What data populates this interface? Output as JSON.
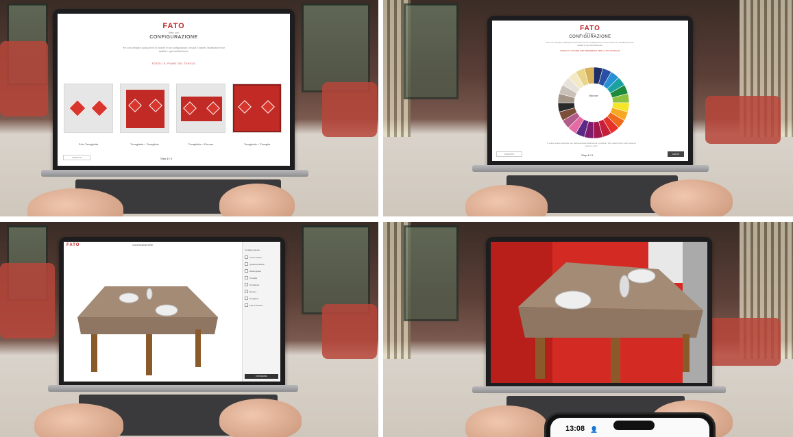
{
  "panels": [
    {
      "brand": "FATO",
      "subtitle": "Step uno",
      "title": "CONFIGURAZIONE",
      "intro": "Per una semplice guida prima di iniziare le tue configurazioni, rimuovi il banner. Modificare le tue qualità e ogni cambiamento.",
      "section_label": "SCEGLI IL PIANO DEL TAVOLO",
      "options": [
        "Solo Tovaglietta",
        "Tovagliette + Tovagliolo",
        "Tovagliette + Runner",
        "Tovagliette + Tovaglia"
      ],
      "back_button": "INDIETRO",
      "pager_label": "Step",
      "pager_current": "2",
      "pager_total": "/ 5"
    },
    {
      "brand": "FATO",
      "subtitle": "Step uno",
      "title": "CONFIGURAZIONE",
      "intro": "Per una semplice guida prima di iniziare le tue configurazioni, rimuovi il banner. Modificare le tue qualità e ogni cambiamento.",
      "section_label": "SCEGLI IL COLORE CHE PREFERISCI PER LA TUA TOVAGLIA",
      "wheel_center": "Marrone",
      "note": "Il colore scelto potrebbe non rappresentare fedelmente il prodotto. Per vedere tutti i colori visita la sezione colori.",
      "back_button": "INDIETRO",
      "next_button": "AVANTI",
      "pager_label": "Step",
      "pager_current": "4",
      "pager_total": "/ 5",
      "wheel_colors": [
        "#1f2f66",
        "#2a4fa6",
        "#2791d6",
        "#1aa2a0",
        "#1e8a3c",
        "#8cc23f",
        "#f4e526",
        "#f7a823",
        "#ef6a1d",
        "#e5312a",
        "#c61f3a",
        "#a3174d",
        "#7e1d6e",
        "#5b2a86",
        "#e36aa3",
        "#b35c8b",
        "#7b4f3a",
        "#2a2a2a",
        "#a39587",
        "#c9c1b7",
        "#e7e2da",
        "#f3e9c7",
        "#e9d48a",
        "#d8b25a"
      ]
    },
    {
      "brand": "FATO",
      "header": "CONFIGURATORE",
      "sidebar_title": "Configura tavolo",
      "sidebar_rows": [
        "Forme tavolo",
        "Quadrata 90x90",
        "Rettangolare",
        "Tovaglia",
        "Tovagliette",
        "Runner",
        "Tovagliolo",
        "Tipo di tessuto"
      ],
      "cta": "CONFERMA"
    },
    {
      "phone_time": "13:08"
    }
  ],
  "colors": {
    "brand_red": "#c0282a",
    "tablecloth": "#a38b75",
    "table_leg": "#8a5a2b",
    "sofa_red": "#e0302a"
  }
}
